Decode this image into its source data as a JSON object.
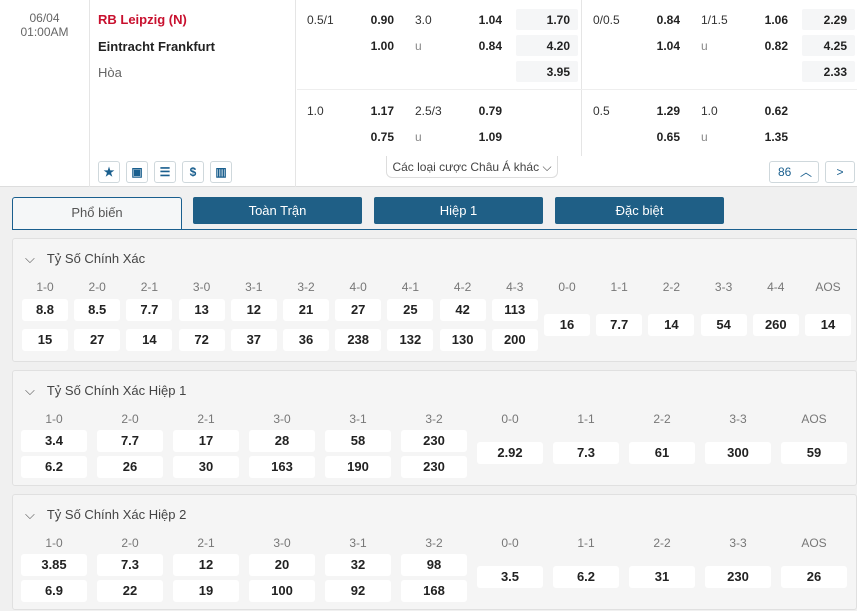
{
  "match": {
    "date": "06/04",
    "time": "01:00AM",
    "home": "RB Leipzig (N)",
    "away": "Eintracht Frankfurt",
    "draw": "Hòa"
  },
  "odds": {
    "r1": {
      "h1": "0.5/1",
      "h1o": "0.90",
      "ou1": "3.0",
      "ou1o": "1.04",
      "x1": "1.70",
      "h2": "0/0.5",
      "h2o": "0.84",
      "ou2": "1/1.5",
      "ou2o": "1.06",
      "x2": "2.29"
    },
    "r2": {
      "h1o": "1.00",
      "ou1": "u",
      "ou1o": "0.84",
      "x1": "4.20",
      "h2o": "1.04",
      "ou2": "u",
      "ou2o": "0.82",
      "x2": "4.25"
    },
    "r3": {
      "x1": "3.95",
      "x2": "2.33"
    },
    "r4": {
      "h1": "1.0",
      "h1o": "1.17",
      "ou1": "2.5/3",
      "ou1o": "0.79",
      "h2": "0.5",
      "h2o": "1.29",
      "ou2": "1.0",
      "ou2o": "0.62"
    },
    "r5": {
      "h1o": "0.75",
      "ou1": "u",
      "ou1o": "1.09",
      "h2o": "0.65",
      "ou2": "u",
      "ou2o": "1.35"
    }
  },
  "more_label": "Các loại cược Châu Á khác",
  "pager_count": "86",
  "tabs": [
    "Phổ biến",
    "Toàn Trận",
    "Hiệp 1",
    "Đặc biệt"
  ],
  "s1": {
    "title": "Tỷ Số Chính Xác",
    "headers": [
      "1-0",
      "2-0",
      "2-1",
      "3-0",
      "3-1",
      "3-2",
      "4-0",
      "4-1",
      "4-2",
      "4-3",
      "0-0",
      "1-1",
      "2-2",
      "3-3",
      "4-4",
      "AOS"
    ],
    "top": [
      "8.8",
      "8.5",
      "7.7",
      "13",
      "12",
      "21",
      "27",
      "25",
      "42",
      "113"
    ],
    "bot": [
      "15",
      "27",
      "14",
      "72",
      "37",
      "36",
      "238",
      "132",
      "130",
      "200"
    ],
    "mid": [
      "16",
      "7.7",
      "14",
      "54",
      "260",
      "14"
    ]
  },
  "s2": {
    "title": "Tỷ Số Chính Xác Hiệp 1",
    "headers": [
      "1-0",
      "2-0",
      "2-1",
      "3-0",
      "3-1",
      "3-2",
      "0-0",
      "1-1",
      "2-2",
      "3-3",
      "AOS"
    ],
    "top": [
      "3.4",
      "7.7",
      "17",
      "28",
      "58",
      "230"
    ],
    "bot": [
      "6.2",
      "26",
      "30",
      "163",
      "190",
      "230"
    ],
    "mid": [
      "2.92",
      "7.3",
      "61",
      "300",
      "59"
    ]
  },
  "s3": {
    "title": "Tỷ Số Chính Xác Hiệp 2",
    "headers": [
      "1-0",
      "2-0",
      "2-1",
      "3-0",
      "3-1",
      "3-2",
      "0-0",
      "1-1",
      "2-2",
      "3-3",
      "AOS"
    ],
    "top": [
      "3.85",
      "7.3",
      "12",
      "20",
      "32",
      "98"
    ],
    "bot": [
      "6.9",
      "22",
      "19",
      "100",
      "92",
      "168"
    ],
    "mid": [
      "3.5",
      "6.2",
      "31",
      "230",
      "26"
    ]
  }
}
